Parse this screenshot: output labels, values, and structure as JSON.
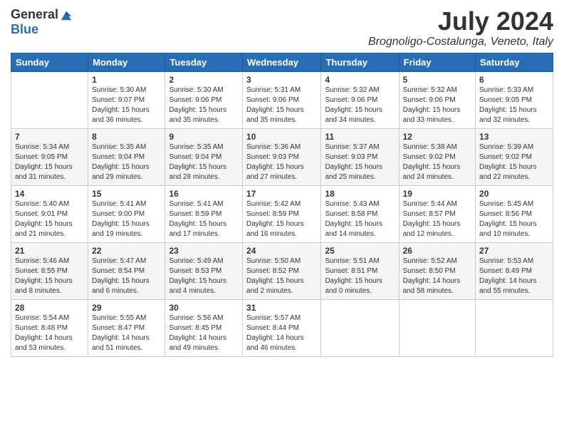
{
  "header": {
    "logo_general": "General",
    "logo_blue": "Blue",
    "month_year": "July 2024",
    "location": "Brognoligo-Costalunga, Veneto, Italy"
  },
  "days_of_week": [
    "Sunday",
    "Monday",
    "Tuesday",
    "Wednesday",
    "Thursday",
    "Friday",
    "Saturday"
  ],
  "weeks": [
    {
      "days": [
        {
          "number": "",
          "info": ""
        },
        {
          "number": "1",
          "info": "Sunrise: 5:30 AM\nSunset: 9:07 PM\nDaylight: 15 hours\nand 36 minutes."
        },
        {
          "number": "2",
          "info": "Sunrise: 5:30 AM\nSunset: 9:06 PM\nDaylight: 15 hours\nand 35 minutes."
        },
        {
          "number": "3",
          "info": "Sunrise: 5:31 AM\nSunset: 9:06 PM\nDaylight: 15 hours\nand 35 minutes."
        },
        {
          "number": "4",
          "info": "Sunrise: 5:32 AM\nSunset: 9:06 PM\nDaylight: 15 hours\nand 34 minutes."
        },
        {
          "number": "5",
          "info": "Sunrise: 5:32 AM\nSunset: 9:06 PM\nDaylight: 15 hours\nand 33 minutes."
        },
        {
          "number": "6",
          "info": "Sunrise: 5:33 AM\nSunset: 9:05 PM\nDaylight: 15 hours\nand 32 minutes."
        }
      ]
    },
    {
      "days": [
        {
          "number": "7",
          "info": "Sunrise: 5:34 AM\nSunset: 9:05 PM\nDaylight: 15 hours\nand 31 minutes."
        },
        {
          "number": "8",
          "info": "Sunrise: 5:35 AM\nSunset: 9:04 PM\nDaylight: 15 hours\nand 29 minutes."
        },
        {
          "number": "9",
          "info": "Sunrise: 5:35 AM\nSunset: 9:04 PM\nDaylight: 15 hours\nand 28 minutes."
        },
        {
          "number": "10",
          "info": "Sunrise: 5:36 AM\nSunset: 9:03 PM\nDaylight: 15 hours\nand 27 minutes."
        },
        {
          "number": "11",
          "info": "Sunrise: 5:37 AM\nSunset: 9:03 PM\nDaylight: 15 hours\nand 25 minutes."
        },
        {
          "number": "12",
          "info": "Sunrise: 5:38 AM\nSunset: 9:02 PM\nDaylight: 15 hours\nand 24 minutes."
        },
        {
          "number": "13",
          "info": "Sunrise: 5:39 AM\nSunset: 9:02 PM\nDaylight: 15 hours\nand 22 minutes."
        }
      ]
    },
    {
      "days": [
        {
          "number": "14",
          "info": "Sunrise: 5:40 AM\nSunset: 9:01 PM\nDaylight: 15 hours\nand 21 minutes."
        },
        {
          "number": "15",
          "info": "Sunrise: 5:41 AM\nSunset: 9:00 PM\nDaylight: 15 hours\nand 19 minutes."
        },
        {
          "number": "16",
          "info": "Sunrise: 5:41 AM\nSunset: 8:59 PM\nDaylight: 15 hours\nand 17 minutes."
        },
        {
          "number": "17",
          "info": "Sunrise: 5:42 AM\nSunset: 8:59 PM\nDaylight: 15 hours\nand 16 minutes."
        },
        {
          "number": "18",
          "info": "Sunrise: 5:43 AM\nSunset: 8:58 PM\nDaylight: 15 hours\nand 14 minutes."
        },
        {
          "number": "19",
          "info": "Sunrise: 5:44 AM\nSunset: 8:57 PM\nDaylight: 15 hours\nand 12 minutes."
        },
        {
          "number": "20",
          "info": "Sunrise: 5:45 AM\nSunset: 8:56 PM\nDaylight: 15 hours\nand 10 minutes."
        }
      ]
    },
    {
      "days": [
        {
          "number": "21",
          "info": "Sunrise: 5:46 AM\nSunset: 8:55 PM\nDaylight: 15 hours\nand 8 minutes."
        },
        {
          "number": "22",
          "info": "Sunrise: 5:47 AM\nSunset: 8:54 PM\nDaylight: 15 hours\nand 6 minutes."
        },
        {
          "number": "23",
          "info": "Sunrise: 5:49 AM\nSunset: 8:53 PM\nDaylight: 15 hours\nand 4 minutes."
        },
        {
          "number": "24",
          "info": "Sunrise: 5:50 AM\nSunset: 8:52 PM\nDaylight: 15 hours\nand 2 minutes."
        },
        {
          "number": "25",
          "info": "Sunrise: 5:51 AM\nSunset: 8:51 PM\nDaylight: 15 hours\nand 0 minutes."
        },
        {
          "number": "26",
          "info": "Sunrise: 5:52 AM\nSunset: 8:50 PM\nDaylight: 14 hours\nand 58 minutes."
        },
        {
          "number": "27",
          "info": "Sunrise: 5:53 AM\nSunset: 8:49 PM\nDaylight: 14 hours\nand 55 minutes."
        }
      ]
    },
    {
      "days": [
        {
          "number": "28",
          "info": "Sunrise: 5:54 AM\nSunset: 8:48 PM\nDaylight: 14 hours\nand 53 minutes."
        },
        {
          "number": "29",
          "info": "Sunrise: 5:55 AM\nSunset: 8:47 PM\nDaylight: 14 hours\nand 51 minutes."
        },
        {
          "number": "30",
          "info": "Sunrise: 5:56 AM\nSunset: 8:45 PM\nDaylight: 14 hours\nand 49 minutes."
        },
        {
          "number": "31",
          "info": "Sunrise: 5:57 AM\nSunset: 8:44 PM\nDaylight: 14 hours\nand 46 minutes."
        },
        {
          "number": "",
          "info": ""
        },
        {
          "number": "",
          "info": ""
        },
        {
          "number": "",
          "info": ""
        }
      ]
    }
  ]
}
